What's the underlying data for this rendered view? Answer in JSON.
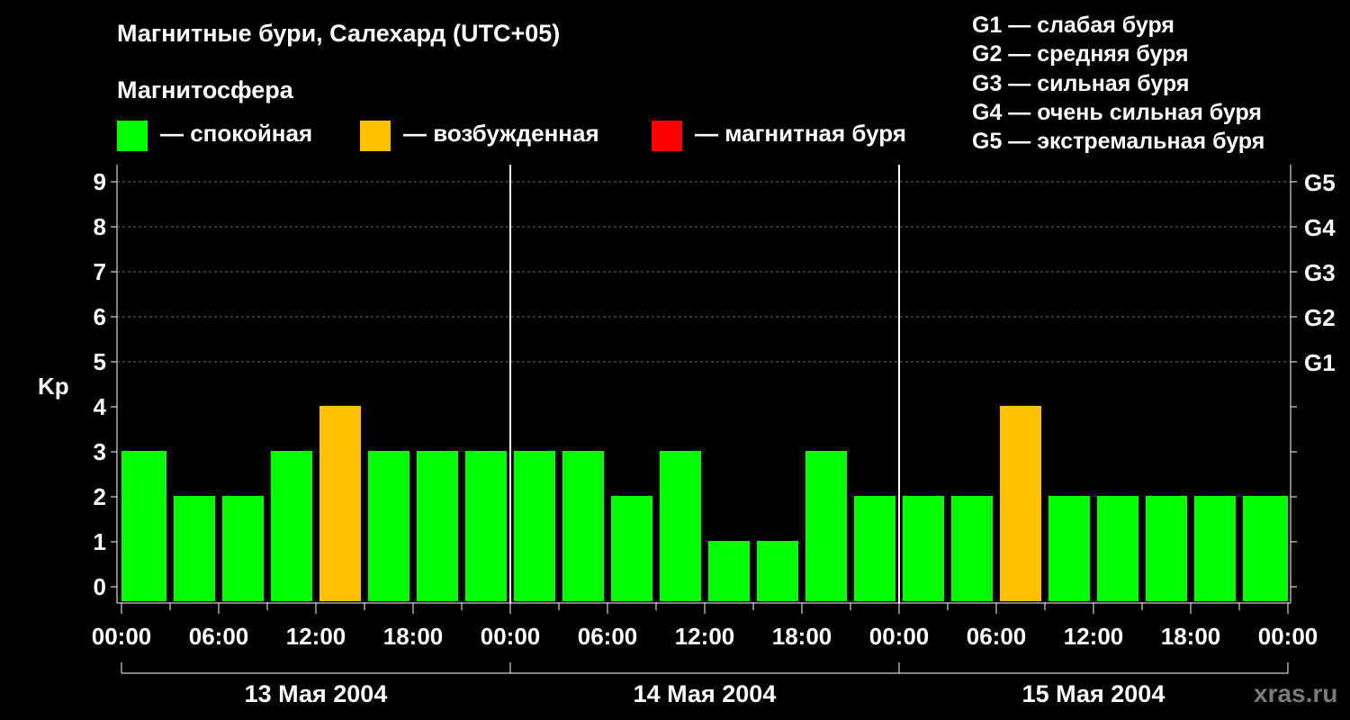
{
  "header": {
    "title": "Магнитные бури, Салехард (UTC+05)",
    "subtitle": "Магнитосфера"
  },
  "legend": [
    {
      "color": "#00ff00",
      "label": "— спокойная"
    },
    {
      "color": "#ffc000",
      "label": "— возбужденная"
    },
    {
      "color": "#ff0000",
      "label": "— магнитная буря"
    }
  ],
  "g_legend": [
    "G1 — слабая буря",
    "G2 — средняя буря",
    "G3 — сильная буря",
    "G4 — очень сильная буря",
    "G5 — экстремальная буря"
  ],
  "watermark": "xras.ru",
  "chart_data": {
    "type": "bar",
    "ylabel": "Kp",
    "ylim": [
      0,
      9
    ],
    "yticks": [
      0,
      1,
      2,
      3,
      4,
      5,
      6,
      7,
      8,
      9
    ],
    "right_ticks": [
      {
        "value": 5,
        "label": "G1"
      },
      {
        "value": 6,
        "label": "G2"
      },
      {
        "value": 7,
        "label": "G3"
      },
      {
        "value": 8,
        "label": "G4"
      },
      {
        "value": 9,
        "label": "G5"
      }
    ],
    "grid": true,
    "xticks": [
      "00:00",
      "06:00",
      "12:00",
      "18:00",
      "00:00",
      "06:00",
      "12:00",
      "18:00",
      "00:00",
      "06:00",
      "12:00",
      "18:00",
      "00:00"
    ],
    "days": [
      "13 Мая 2004",
      "14 Мая 2004",
      "15 Мая 2004"
    ],
    "intervals_per_day": 8,
    "values": [
      3,
      2,
      2,
      3,
      4,
      3,
      3,
      3,
      3,
      3,
      2,
      3,
      1,
      1,
      3,
      2,
      2,
      2,
      4,
      2,
      2,
      2,
      2,
      2
    ],
    "colors": {
      "quiet": "#00ff00",
      "active": "#ffc000",
      "storm": "#ff0000"
    }
  }
}
